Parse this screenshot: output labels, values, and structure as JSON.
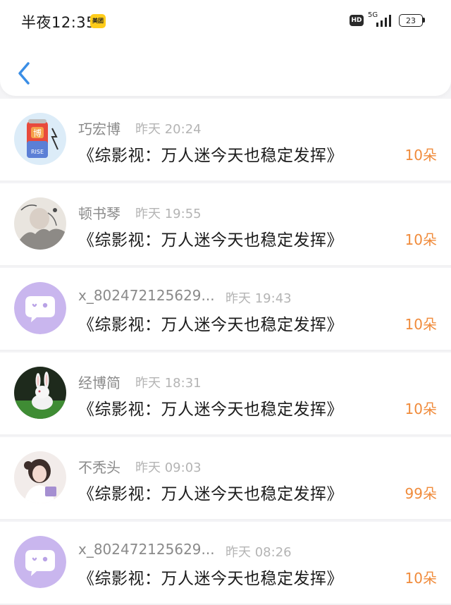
{
  "status_bar": {
    "time": "半夜12:35",
    "app_badge": "美团",
    "hd": "HD",
    "network": "5G",
    "battery": "23"
  },
  "messages": [
    {
      "name": "巧宏博",
      "time": "昨天 20:24",
      "gift": "《综影视：万人迷今天也稳定发挥》",
      "count": "10朵",
      "avatar": "can-icon",
      "avatar_text": "博",
      "avatar_subtext": "RISE"
    },
    {
      "name": "顿书琴",
      "time": "昨天 19:55",
      "gift": "《综影视：万人迷今天也稳定发挥》",
      "count": "10朵",
      "avatar": "ink-painting"
    },
    {
      "name": "x_802472125629...",
      "time": "昨天 19:43",
      "gift": "《综影视：万人迷今天也稳定发挥》",
      "count": "10朵",
      "avatar": "default-chat-bubble"
    },
    {
      "name": "经博简",
      "time": "昨天 18:31",
      "gift": "《综影视：万人迷今天也稳定发挥》",
      "count": "10朵",
      "avatar": "white-rabbit"
    },
    {
      "name": "不秃头",
      "time": "昨天 09:03",
      "gift": "《综影视：万人迷今天也稳定发挥》",
      "count": "99朵",
      "avatar": "girl-photo"
    },
    {
      "name": "x_802472125629...",
      "time": "昨天 08:26",
      "gift": "《综影视：万人迷今天也稳定发挥》",
      "count": "10朵",
      "avatar": "default-chat-bubble"
    }
  ],
  "colors": {
    "accent_blue": "#3a8ee6",
    "count_orange": "#f08b3b",
    "default_avatar": "#c9b6ee"
  }
}
